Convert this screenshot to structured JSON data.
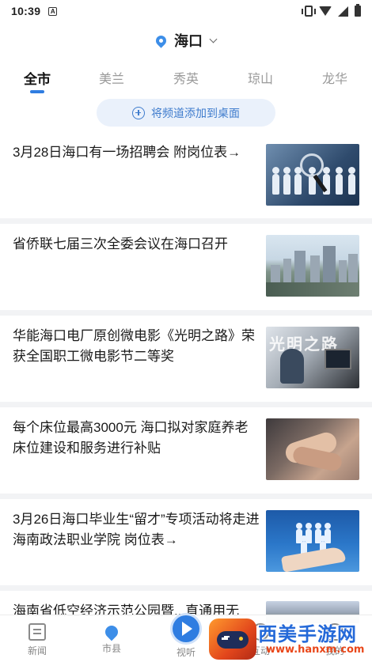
{
  "status_bar": {
    "time": "10:39",
    "notification_icon": "A"
  },
  "location": {
    "city": "海口"
  },
  "tabs": [
    {
      "label": "全市",
      "active": true
    },
    {
      "label": "美兰",
      "active": false
    },
    {
      "label": "秀英",
      "active": false
    },
    {
      "label": "琼山",
      "active": false
    },
    {
      "label": "龙华",
      "active": false
    }
  ],
  "add_channel": {
    "label": "将频道添加到桌面"
  },
  "news": [
    {
      "title": "3月28日海口有一场招聘会  附岗位表→",
      "image": "people-magnifier"
    },
    {
      "title": "省侨联七届三次全委会议在海口召开",
      "image": "city-skyline"
    },
    {
      "title": "华能海口电厂原创微电影《光明之路》荣获全国职工微电影节二等奖",
      "image": "film-still"
    },
    {
      "title": "每个床位最高3000元 海口拟对家庭养老床位建设和服务进行补贴",
      "image": "holding-hands"
    },
    {
      "title": "3月26日海口毕业生“留才”专项活动将走进海南政法职业学院  岗位表→",
      "image": "blue-people-hand"
    },
    {
      "title": "海南省低空经济示范公园暨...直通用无",
      "image": "park"
    }
  ],
  "bottom_nav": [
    {
      "label": "新闻",
      "icon": "news-icon"
    },
    {
      "label": "市县",
      "icon": "location-pin-icon"
    },
    {
      "label": "视听",
      "icon": "play-icon"
    },
    {
      "label": "互动",
      "icon": "interact-icon"
    },
    {
      "label": "我的",
      "icon": "profile-icon"
    }
  ],
  "watermark": {
    "title": "西美手游网",
    "url": "www.hanxm.com"
  },
  "colors": {
    "accent": "#2f7de1",
    "pin": "#3d8ee8",
    "chip_bg": "#eaf1fb",
    "separator": "#f2f3f5"
  }
}
